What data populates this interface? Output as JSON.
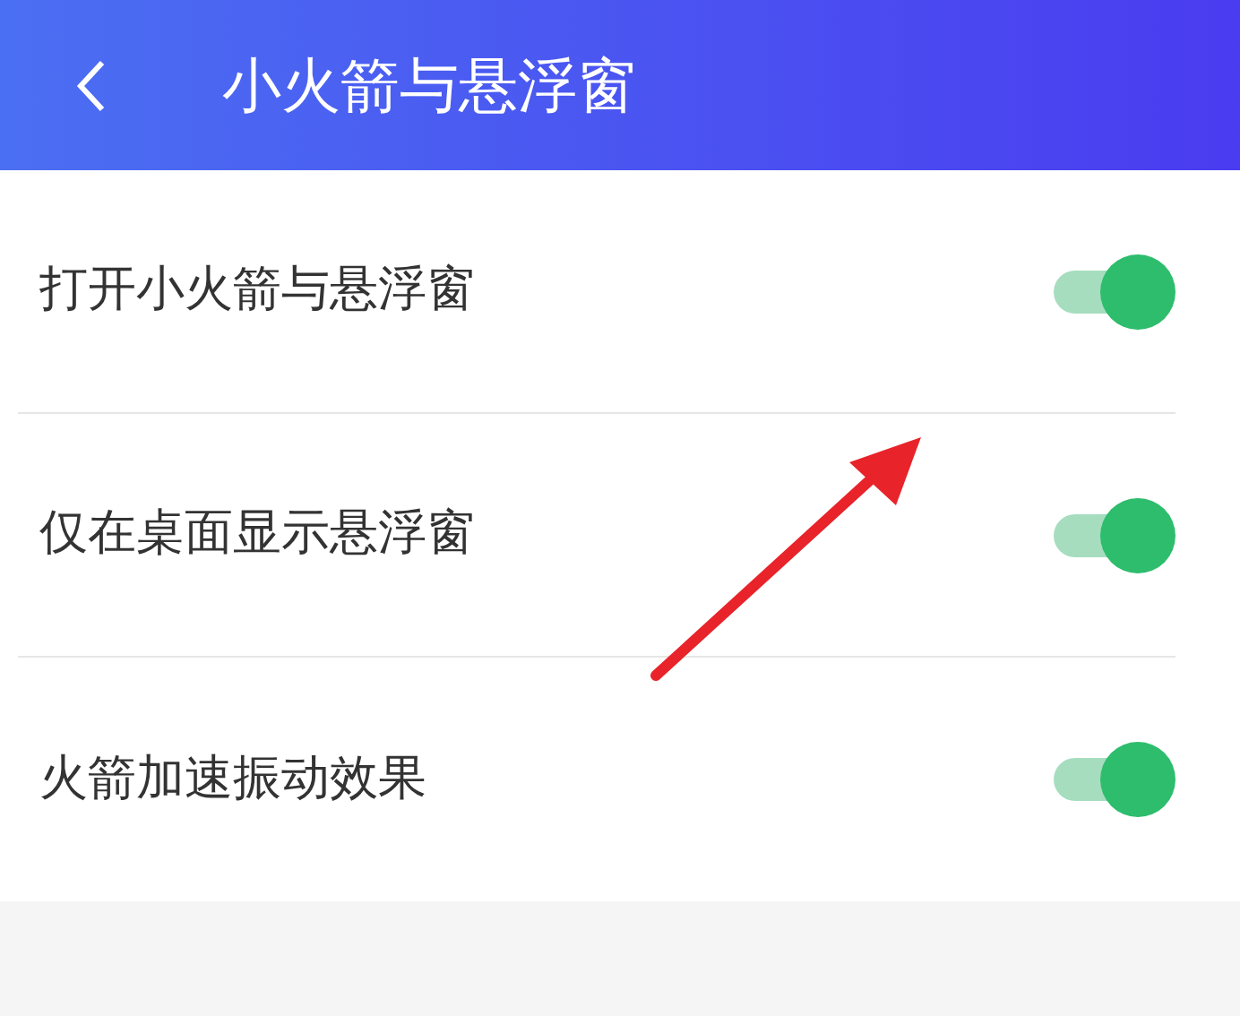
{
  "header": {
    "title": "小火箭与悬浮窗"
  },
  "settings": [
    {
      "label": "打开小火箭与悬浮窗",
      "on": true
    },
    {
      "label": "仅在桌面显示悬浮窗",
      "on": true
    },
    {
      "label": "火箭加速振动效果",
      "on": true
    }
  ]
}
